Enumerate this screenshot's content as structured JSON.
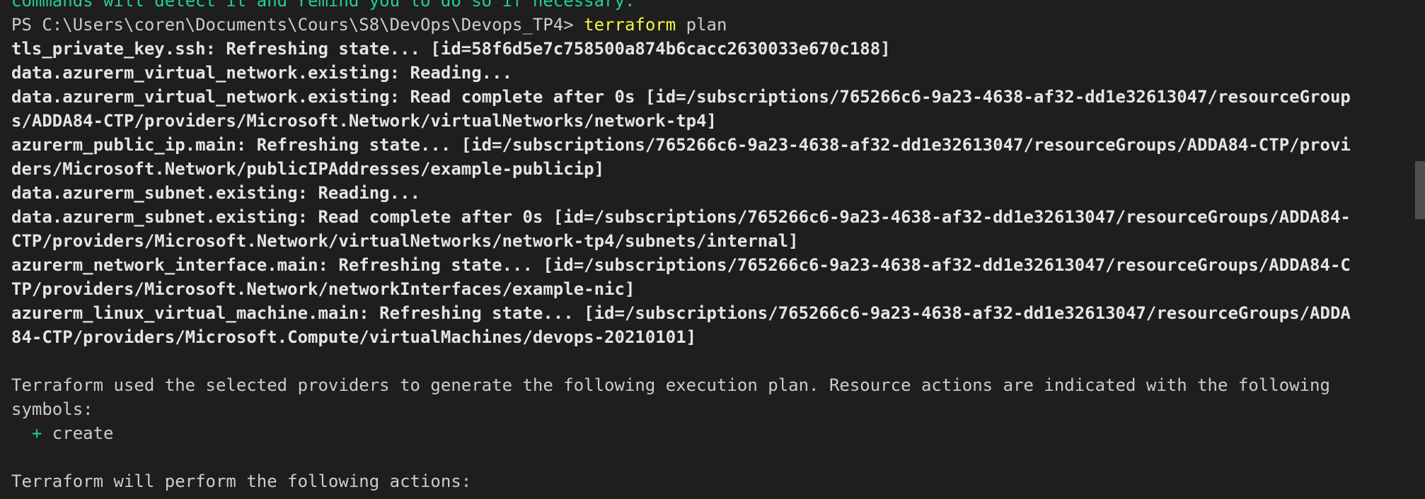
{
  "terminal": {
    "cut_top_line": "commands will detect it and remind you to do so if necessary.",
    "prompt": "PS C:\\Users\\coren\\Documents\\Cours\\S8\\DevOps\\Devops_TP4> ",
    "command": "terraform",
    "command_args": " plan",
    "output": [
      "tls_private_key.ssh: Refreshing state... [id=58f6d5e7c758500a874b6cacc2630033e670c188]",
      "data.azurerm_virtual_network.existing: Reading...",
      "data.azurerm_virtual_network.existing: Read complete after 0s [id=/subscriptions/765266c6-9a23-4638-af32-dd1e32613047/resourceGroup",
      "s/ADDA84-CTP/providers/Microsoft.Network/virtualNetworks/network-tp4]",
      "azurerm_public_ip.main: Refreshing state... [id=/subscriptions/765266c6-9a23-4638-af32-dd1e32613047/resourceGroups/ADDA84-CTP/provi",
      "ders/Microsoft.Network/publicIPAddresses/example-publicip]",
      "data.azurerm_subnet.existing: Reading...",
      "data.azurerm_subnet.existing: Read complete after 0s [id=/subscriptions/765266c6-9a23-4638-af32-dd1e32613047/resourceGroups/ADDA84-",
      "CTP/providers/Microsoft.Network/virtualNetworks/network-tp4/subnets/internal]",
      "azurerm_network_interface.main: Refreshing state... [id=/subscriptions/765266c6-9a23-4638-af32-dd1e32613047/resourceGroups/ADDA84-C",
      "TP/providers/Microsoft.Network/networkInterfaces/example-nic]",
      "azurerm_linux_virtual_machine.main: Refreshing state... [id=/subscriptions/765266c6-9a23-4638-af32-dd1e32613047/resourceGroups/ADDA",
      "84-CTP/providers/Microsoft.Compute/virtualMachines/devops-20210101]"
    ],
    "plan_intro_1": "Terraform used the selected providers to generate the following execution plan. Resource actions are indicated with the following",
    "plan_intro_2": "symbols:",
    "symbol_plus": "+",
    "symbol_label": " create",
    "actions_line": "Terraform will perform the following actions:"
  },
  "colors": {
    "background": "#1e1e1e",
    "text": "#cccccc",
    "command": "#f5f543",
    "create_symbol": "#23d18b"
  }
}
